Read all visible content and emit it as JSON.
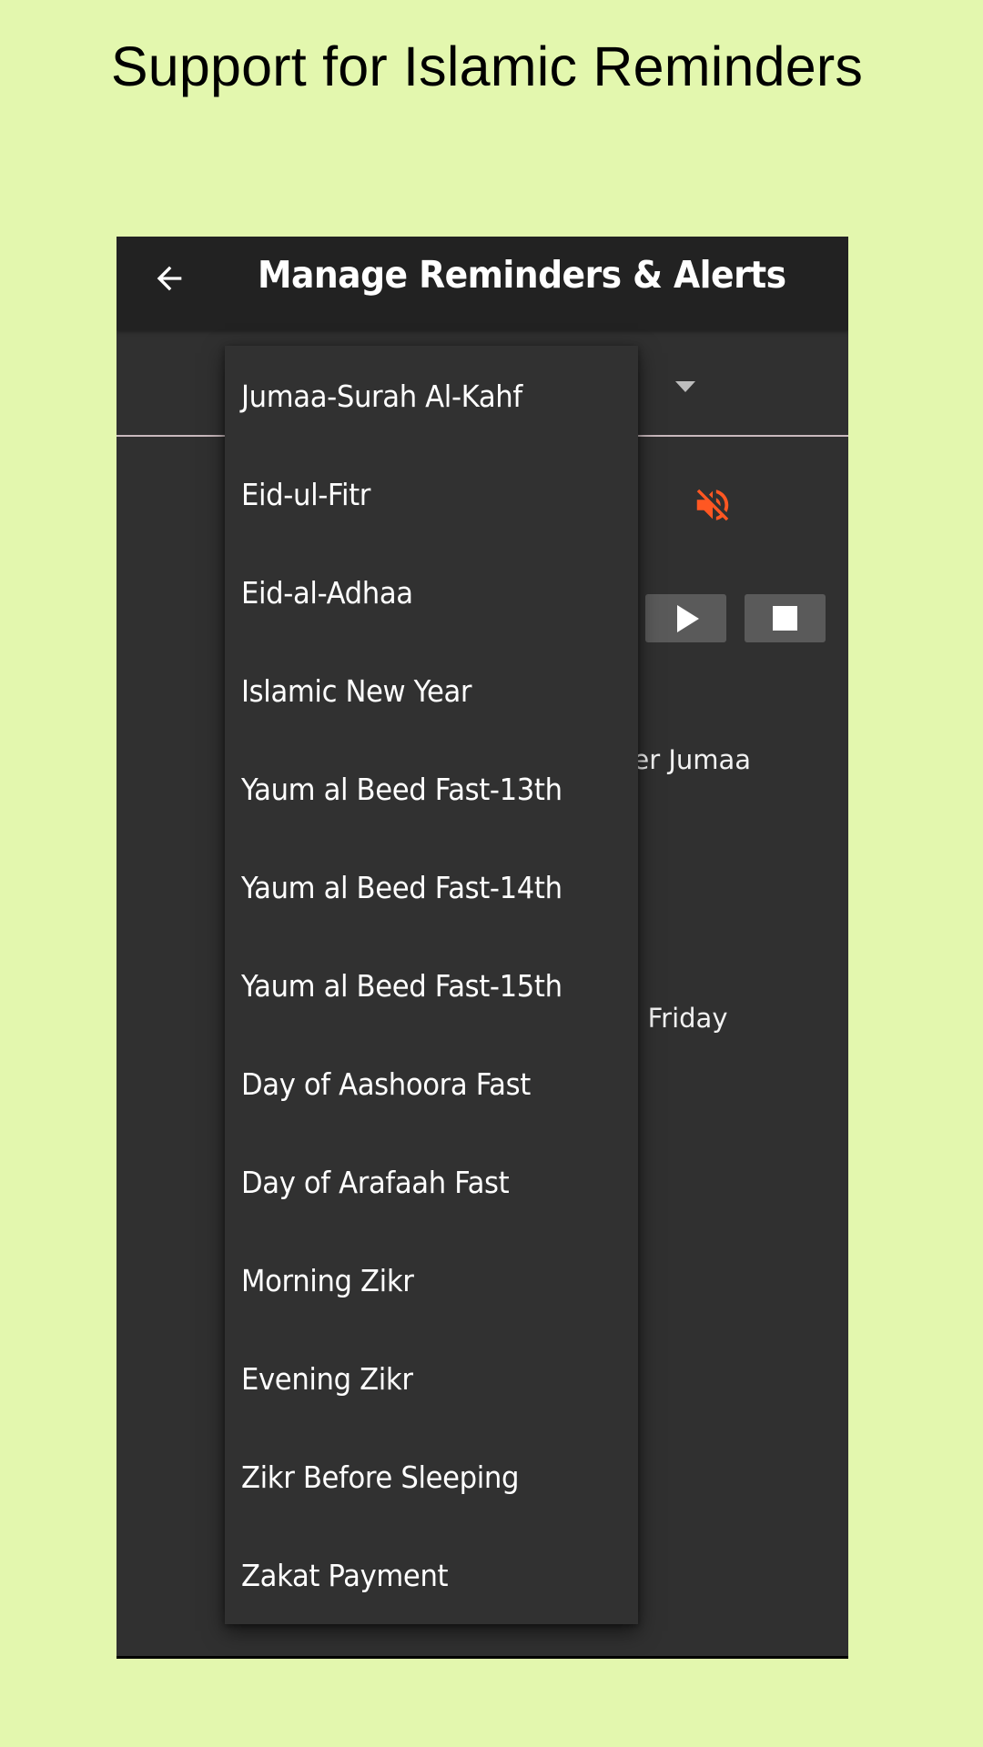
{
  "promo": {
    "title": "Support for Islamic Reminders"
  },
  "app": {
    "toolbar": {
      "back_icon": "arrow-left-icon",
      "title": "Manage Reminders & Alerts"
    },
    "spinner": {
      "arrow_icon": "dropdown-arrow-icon"
    },
    "controls": {
      "mute_icon": "volume-off-icon",
      "mute_color": "#ff5722",
      "play_icon": "play-icon",
      "stop_icon": "stop-icon"
    },
    "background_text": {
      "line1_partial": "ter Jumaa",
      "line2_partial": "n Friday"
    },
    "dropdown": {
      "items": [
        {
          "label": "Jumaa-Surah Al-Kahf"
        },
        {
          "label": "Eid-ul-Fitr"
        },
        {
          "label": "Eid-al-Adhaa"
        },
        {
          "label": "Islamic New Year"
        },
        {
          "label": "Yaum al Beed Fast-13th"
        },
        {
          "label": "Yaum al Beed Fast-14th"
        },
        {
          "label": "Yaum al Beed Fast-15th"
        },
        {
          "label": "Day of Aashoora Fast"
        },
        {
          "label": "Day of Arafaah Fast"
        },
        {
          "label": "Morning Zikr"
        },
        {
          "label": "Evening Zikr"
        },
        {
          "label": "Zikr Before Sleeping"
        },
        {
          "label": "Zakat Payment"
        }
      ]
    }
  },
  "colors": {
    "page_background": "#e3f7ae",
    "toolbar": "#222222",
    "screen": "#303030",
    "dropdown": "#313131",
    "accent_orange": "#ff5722"
  }
}
